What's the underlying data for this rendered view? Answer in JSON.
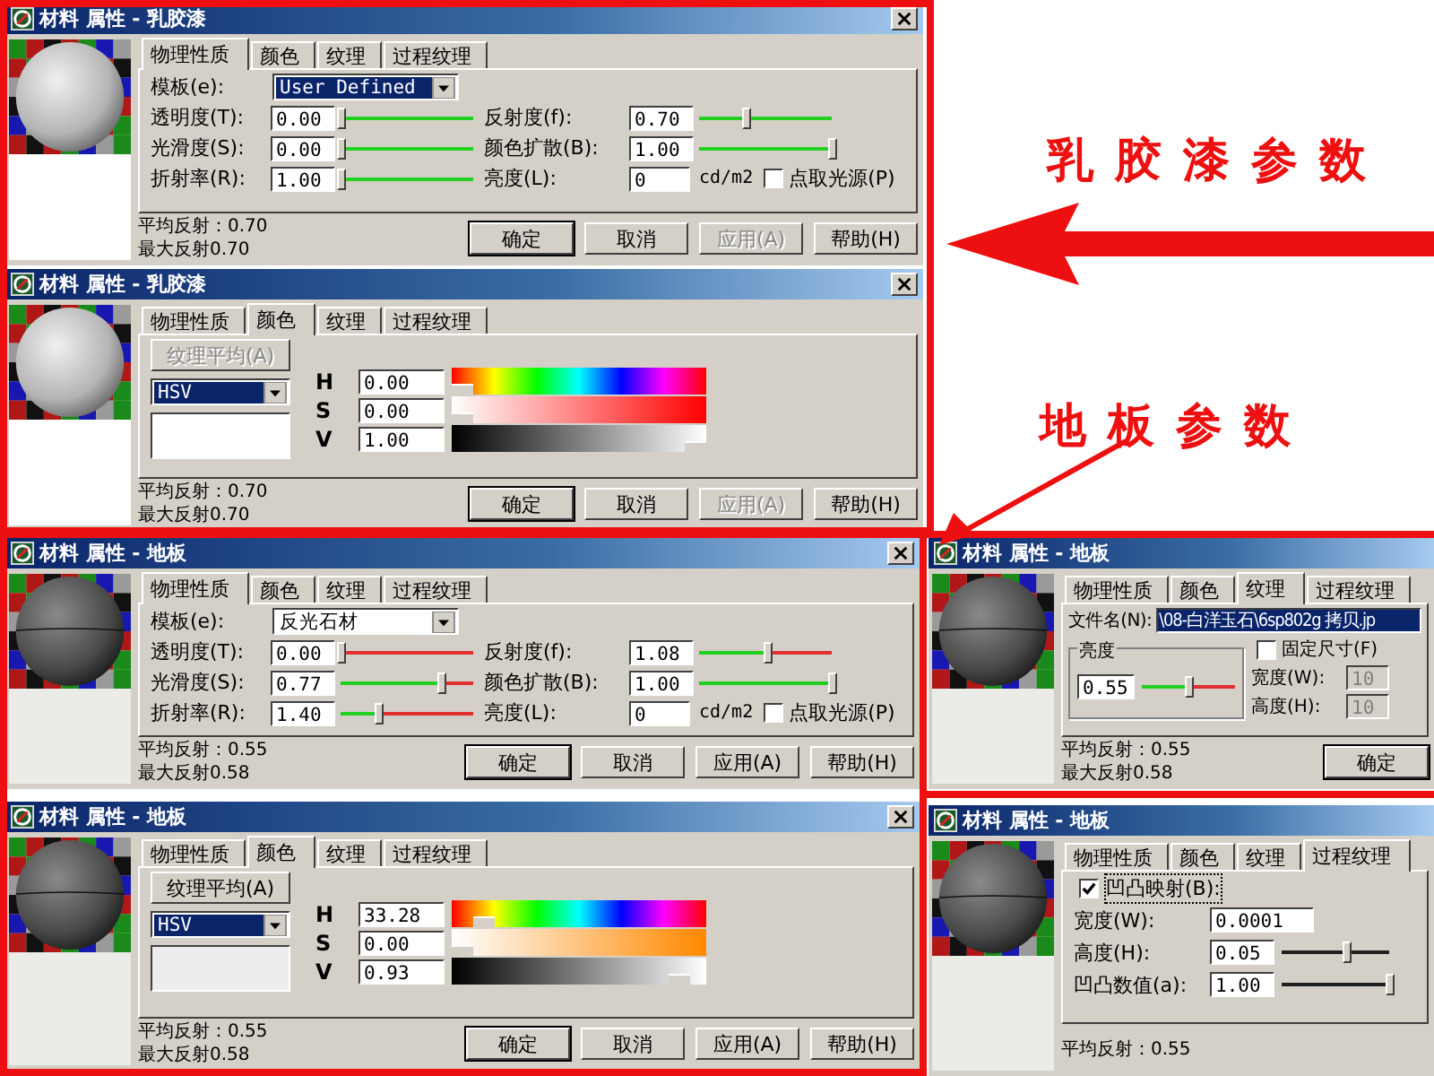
{
  "windows": [
    {
      "kind": "physical",
      "title": "材料 属性 - 乳胶漆",
      "tabs": [
        {
          "label": "物理性质",
          "selected": true
        },
        {
          "label": "颜色",
          "selected": false
        },
        {
          "label": "纹理",
          "selected": false
        },
        {
          "label": "过程纹理",
          "selected": false
        }
      ],
      "template": {
        "label": "模板(e):",
        "value": "User Defined",
        "highlighted": true
      },
      "params": [
        {
          "kind": "slider",
          "label": "透明度(T):",
          "value": "0.00",
          "level": 0
        },
        {
          "kind": "slider",
          "label": "反射度(f):",
          "value": "0.70",
          "level": 0.35
        },
        {
          "kind": "slider",
          "label": "光滑度(S):",
          "value": "0.00",
          "level": 0
        },
        {
          "kind": "slider",
          "label": "颜色扩散(B):",
          "value": "1.00",
          "level": 1
        },
        {
          "kind": "slider",
          "label": "折射率(R):",
          "value": "1.00",
          "level": 0
        },
        {
          "kind": "unit",
          "label": "亮度(L):",
          "value": "0",
          "unit": "cd/m2",
          "checkbox": {
            "label": "点取光源(P)",
            "checked": false
          }
        }
      ],
      "stats": [
        "平均反射：0.70",
        "最大反射0.70"
      ],
      "buttons": [
        {
          "label": "确定",
          "default": true,
          "disabled": false
        },
        {
          "label": "取消",
          "default": false,
          "disabled": false
        },
        {
          "label": "应用(A)",
          "default": false,
          "disabled": true
        },
        {
          "label": "帮助(H)",
          "default": false,
          "disabled": false
        }
      ]
    },
    {
      "kind": "color",
      "title": "材料 属性 - 乳胶漆",
      "tabs": [
        {
          "label": "物理性质",
          "selected": false
        },
        {
          "label": "颜色",
          "selected": true
        },
        {
          "label": "纹理",
          "selected": false
        },
        {
          "label": "过程纹理",
          "selected": false
        }
      ],
      "average_button": {
        "label": "纹理平均(A)",
        "disabled": true
      },
      "mode": {
        "value": "HSV",
        "highlighted": true
      },
      "channels": [
        {
          "label": "H",
          "value": "0.00",
          "level": 0
        },
        {
          "label": "S",
          "value": "0.00",
          "level": 0
        },
        {
          "label": "V",
          "value": "1.00",
          "level": 1
        }
      ],
      "stats": [
        "平均反射：0.70",
        "最大反射0.70"
      ],
      "buttons": [
        {
          "label": "确定",
          "default": true,
          "disabled": false
        },
        {
          "label": "取消",
          "default": false,
          "disabled": false
        },
        {
          "label": "应用(A)",
          "default": false,
          "disabled": true
        },
        {
          "label": "帮助(H)",
          "default": false,
          "disabled": false
        }
      ]
    },
    {
      "kind": "physical",
      "title": "材料 属性 - 地板",
      "tabs": [
        {
          "label": "物理性质",
          "selected": true
        },
        {
          "label": "颜色",
          "selected": false
        },
        {
          "label": "纹理",
          "selected": false
        },
        {
          "label": "过程纹理",
          "selected": false
        }
      ],
      "template": {
        "label": "模板(e):",
        "value": "反光石材",
        "highlighted": false
      },
      "params": [
        {
          "kind": "slider",
          "label": "透明度(T):",
          "value": "0.00",
          "level": 0
        },
        {
          "kind": "slider",
          "label": "反射度(f):",
          "value": "1.08",
          "level": 0.52
        },
        {
          "kind": "slider",
          "label": "光滑度(S):",
          "value": "0.77",
          "level": 0.75
        },
        {
          "kind": "slider",
          "label": "颜色扩散(B):",
          "value": "1.00",
          "level": 1
        },
        {
          "kind": "slider",
          "label": "折射率(R):",
          "value": "1.40",
          "level": 0.28
        },
        {
          "kind": "unit",
          "label": "亮度(L):",
          "value": "0",
          "unit": "cd/m2",
          "checkbox": {
            "label": "点取光源(P)",
            "checked": false
          }
        }
      ],
      "stats": [
        "平均反射：0.55",
        "最大反射0.58"
      ],
      "buttons": [
        {
          "label": "确定",
          "default": true,
          "disabled": false
        },
        {
          "label": "取消",
          "default": false,
          "disabled": false
        },
        {
          "label": "应用(A)",
          "default": false,
          "disabled": false
        },
        {
          "label": "帮助(H)",
          "default": false,
          "disabled": false
        }
      ]
    },
    {
      "kind": "color",
      "title": "材料 属性 - 地板",
      "tabs": [
        {
          "label": "物理性质",
          "selected": false
        },
        {
          "label": "颜色",
          "selected": true
        },
        {
          "label": "纹理",
          "selected": false
        },
        {
          "label": "过程纹理",
          "selected": false
        }
      ],
      "average_button": {
        "label": "纹理平均(A)",
        "disabled": false
      },
      "mode": {
        "value": "HSV",
        "highlighted": true
      },
      "channels": [
        {
          "label": "H",
          "value": "33.28",
          "level": 0.09
        },
        {
          "label": "S",
          "value": "0.00",
          "level": 0
        },
        {
          "label": "V",
          "value": "0.93",
          "level": 0.93
        }
      ],
      "stats": [
        "平均反射：0.55",
        "最大反射0.58"
      ],
      "buttons": [
        {
          "label": "确定",
          "default": true,
          "disabled": false
        },
        {
          "label": "取消",
          "default": false,
          "disabled": false
        },
        {
          "label": "应用(A)",
          "default": false,
          "disabled": false
        },
        {
          "label": "帮助(H)",
          "default": false,
          "disabled": false
        }
      ]
    },
    {
      "kind": "texture",
      "title": "材料 属性 - 地板",
      "tabs": [
        {
          "label": "物理性质",
          "selected": false
        },
        {
          "label": "颜色",
          "selected": false
        },
        {
          "label": "纹理",
          "selected": true
        },
        {
          "label": "过程纹理",
          "selected": false
        }
      ],
      "file": {
        "label": "文件名(N):",
        "value": "\\08-白洋玉石\\6sp802g 拷贝.jp"
      },
      "brightness": {
        "title": "亮度",
        "value": "0.55",
        "level": 0.5
      },
      "fixed_size": {
        "label": "固定尺寸(F)",
        "checked": false
      },
      "size_fields": [
        {
          "label": "宽度(W):",
          "value": "10",
          "disabled": true
        },
        {
          "label": "高度(H):",
          "value": "10",
          "disabled": true
        }
      ],
      "stats": [
        "平均反射：0.55",
        "最大反射0.58"
      ],
      "buttons": [
        {
          "label": "确定",
          "default": true,
          "disabled": false
        }
      ]
    },
    {
      "kind": "procedural",
      "title": "材料 属性 - 地板",
      "tabs": [
        {
          "label": "物理性质",
          "selected": false
        },
        {
          "label": "颜色",
          "selected": false
        },
        {
          "label": "纹理",
          "selected": false
        },
        {
          "label": "过程纹理",
          "selected": true
        }
      ],
      "bump": {
        "label": "凹凸映射(B):",
        "checked": true
      },
      "fields": [
        {
          "kind": "text",
          "label": "宽度(W):",
          "value": "0.0001"
        },
        {
          "kind": "slider",
          "label": "高度(H):",
          "value": "0.05",
          "level": 0.6
        },
        {
          "kind": "slider",
          "label": "凹凸数值(a):",
          "value": "1.00",
          "level": 1
        }
      ],
      "stats": [
        "平均反射：0.55"
      ]
    }
  ],
  "annotations": [
    {
      "text": "乳胶漆参数"
    },
    {
      "text": "地板参数"
    }
  ]
}
